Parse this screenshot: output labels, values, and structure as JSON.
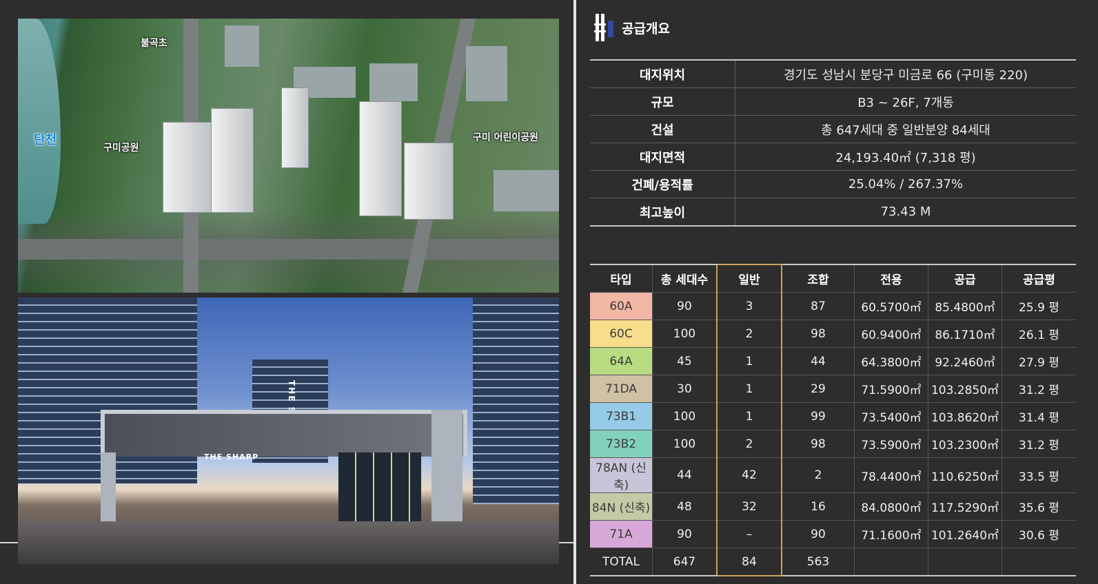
{
  "aerial": {
    "labels": {
      "school": "불곡초",
      "river": "탄천",
      "park_left": "구미공원",
      "park_right": "구미 어린이공원"
    }
  },
  "street": {
    "gate_sign": "THE SHARP",
    "tower_sign": "THE SHA"
  },
  "header": {
    "title": "공급개요",
    "icon": "sharp-logo-icon",
    "icon_accent_color": "#2f4a9f"
  },
  "summary": {
    "rows": [
      {
        "label": "대지위치",
        "value": "경기도 성남시 분당구 미금로 66 (구미동 220)"
      },
      {
        "label": "규모",
        "value": "B3 ~ 26F,  7개동"
      },
      {
        "label": "건설",
        "value": "총 647세대 중 일반분양 84세대"
      },
      {
        "label": "대지면적",
        "value": "24,193.40㎡ (7,318 평)"
      },
      {
        "label": "건폐/용적률",
        "value": "25.04% / 267.37%"
      },
      {
        "label": "최고높이",
        "value": "73.43 M"
      }
    ]
  },
  "units": {
    "headers": [
      "타입",
      "총 세대수",
      "일반",
      "조합",
      "전용",
      "공급",
      "공급평"
    ],
    "highlight_color": "#caa25a",
    "rows": [
      {
        "type": "60A",
        "color": "#f3b7a5",
        "total": "90",
        "general": "3",
        "union": "87",
        "exclusive": "60.5700㎡",
        "supply": "85.4800㎡",
        "pyeong": "25.9 평"
      },
      {
        "type": "60C",
        "color": "#f8dd8c",
        "total": "100",
        "general": "2",
        "union": "98",
        "exclusive": "60.9400㎡",
        "supply": "86.1710㎡",
        "pyeong": "26.1 평"
      },
      {
        "type": "64A",
        "color": "#b9dc83",
        "total": "45",
        "general": "1",
        "union": "44",
        "exclusive": "64.3800㎡",
        "supply": "92.2460㎡",
        "pyeong": "27.9 평"
      },
      {
        "type": "71DA",
        "color": "#cfc2a2",
        "total": "30",
        "general": "1",
        "union": "29",
        "exclusive": "71.5900㎡",
        "supply": "103.2850㎡",
        "pyeong": "31.2 평"
      },
      {
        "type": "73B1",
        "color": "#95cbe6",
        "total": "100",
        "general": "1",
        "union": "99",
        "exclusive": "73.5400㎡",
        "supply": "103.8620㎡",
        "pyeong": "31.4 평"
      },
      {
        "type": "73B2",
        "color": "#82d1bd",
        "total": "100",
        "general": "2",
        "union": "98",
        "exclusive": "73.5900㎡",
        "supply": "103.2300㎡",
        "pyeong": "31.2 평"
      },
      {
        "type": "78AN (신축)",
        "color": "#c9c5d8",
        "total": "44",
        "general": "42",
        "union": "2",
        "exclusive": "78.4400㎡",
        "supply": "110.6250㎡",
        "pyeong": "33.5 평"
      },
      {
        "type": "84N (신축)",
        "color": "#c6c9a6",
        "total": "48",
        "general": "32",
        "union": "16",
        "exclusive": "84.0800㎡",
        "supply": "117.5290㎡",
        "pyeong": "35.6 평"
      },
      {
        "type": "71A",
        "color": "#d7a8d8",
        "total": "90",
        "general": "–",
        "union": "90",
        "exclusive": "71.1600㎡",
        "supply": "101.2640㎡",
        "pyeong": "30.6 평"
      }
    ],
    "total_row": {
      "type": "TOTAL",
      "total": "647",
      "general": "84",
      "union": "563",
      "exclusive": "",
      "supply": "",
      "pyeong": ""
    }
  }
}
